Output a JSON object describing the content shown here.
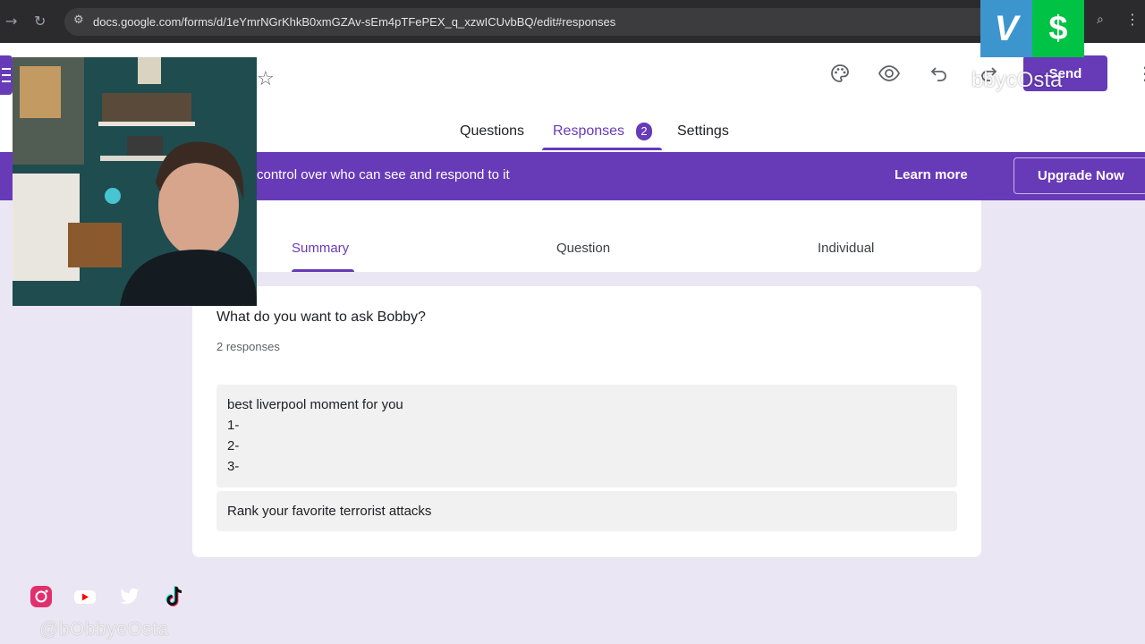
{
  "browser": {
    "url": "docs.google.com/forms/d/1eYmrNGrKhkB0xmGZAv-sEm4pTFePEX_q_xzwICUvbBQ/edit#responses",
    "back_icon": "arrow-right-icon",
    "reload_icon": "reload-icon",
    "site_info_icon": "tune-icon"
  },
  "overlays": {
    "venmo_glyph": "V",
    "cashapp_glyph": "$",
    "streamer_handle": "bbycOsta",
    "social_handle": "@bObbyeOsta",
    "socials": [
      "instagram-icon",
      "youtube-icon",
      "twitter-icon",
      "tiktok-icon"
    ]
  },
  "header": {
    "send_label": "Send",
    "icons": [
      "palette-icon",
      "preview-eye-icon",
      "undo-icon",
      "redo-icon",
      "more-vert-icon"
    ],
    "tabs": [
      {
        "label": "Questions"
      },
      {
        "label": "Responses",
        "count": "2"
      },
      {
        "label": "Settings"
      }
    ]
  },
  "banner": {
    "text": "control over who can see and respond to it",
    "learn_more": "Learn more",
    "upgrade": "Upgrade Now"
  },
  "responses_view": {
    "tabs": [
      {
        "label": "Summary"
      },
      {
        "label": "Question"
      },
      {
        "label": "Individual"
      }
    ]
  },
  "question": {
    "title": "What do you want to ask Bobby?",
    "count": "2 responses",
    "answers": [
      {
        "lines": [
          "best liverpool moment for you",
          "1-",
          "2-",
          "3-"
        ]
      },
      {
        "lines": [
          "Rank your favorite terrorist attacks"
        ]
      }
    ]
  },
  "colors": {
    "accent": "#673ab7",
    "page_bg": "#ebe6f3",
    "browser_bar": "#2b2b2d",
    "venmo": "#3d95ce",
    "cashapp": "#00c244"
  }
}
